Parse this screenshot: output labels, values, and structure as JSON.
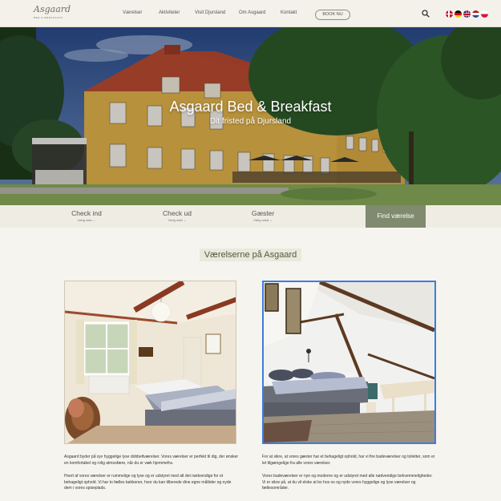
{
  "header": {
    "logo_text": "Asgaard",
    "logo_subtext": "BED & BREAKFAST",
    "nav": [
      "Værelser",
      "Aktiviteter",
      "Visit Djursland",
      "Om Asgaard",
      "Kontakt"
    ],
    "book_label": "BOOK NU",
    "search_icon": "search-icon",
    "flags": [
      "danish-flag-icon",
      "german-flag-icon",
      "uk-flag-icon",
      "dutch-flag-icon",
      "polish-flag-icon"
    ]
  },
  "hero": {
    "title": "Asgaard Bed & Breakfast",
    "subtitle": "Dit fristed på Djursland"
  },
  "booking": {
    "checkin_label": "Check ind",
    "checkin_sub": "Vælg dato",
    "checkout_label": "Check ud",
    "checkout_sub": "Vælg dato",
    "guests_label": "Gæster",
    "guests_sub": "Vælg antal",
    "find_label": "Find værelse"
  },
  "section": {
    "title": "Værelserne på Asgaard"
  },
  "rooms": {
    "left_p1": "Asgaard byder på syv hyggelige lyse dobbeltværelser. Vores værelser er perfekt til dig, der ønsker en komfortabel og rolig atmosfære, når du er væk hjemmefra.",
    "left_p2": "Hvert af vores værelser er rummelige og lyse og er udstyret med alt det nødvendige for et behageligt ophold. Vi har to fælles køkkener, hvor du kan tilberede dine egne måltider og nyde dem i vores spiseplads.",
    "right_p1": "For at sikre, at vores gæster har et behageligt ophold, har vi fire badeværelser og toiletter, som er let tilgængelige fra alle vores værelser.",
    "right_p2": "Vores badeværelser er nye og moderne og er udstyret med alle nødvendige bekvemmeligheder. Vi er sikre på, at du vil elske at bo hos os og nyde vores hyggelige og lyse værelser og fællesområder."
  },
  "colors": {
    "accent": "#7f8a6e",
    "header_bg": "#f3f1ea",
    "page_bg": "#f6f4ee",
    "selected_border": "#3b7ddd"
  }
}
